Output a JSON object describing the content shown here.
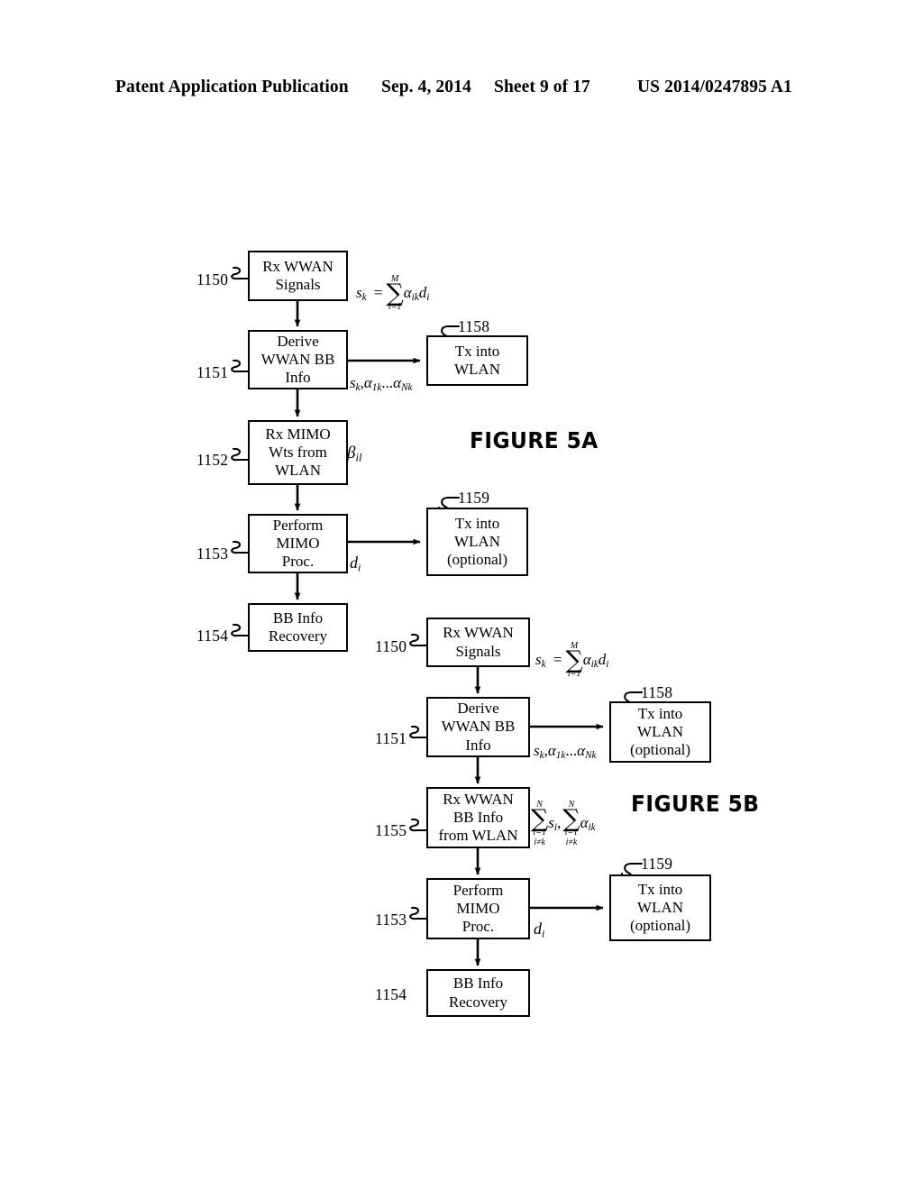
{
  "header": {
    "publication": "Patent Application Publication",
    "date": "Sep. 4, 2014",
    "sheet": "Sheet 9 of 17",
    "patent_number": "US 2014/0247895 A1"
  },
  "figures": [
    {
      "caption": "FIGURE 5A",
      "boxes": [
        {
          "ref": "1150",
          "lines": [
            "Rx WWAN",
            "Signals"
          ]
        },
        {
          "ref": "1151",
          "lines": [
            "Derive",
            "WWAN BB",
            "Info"
          ]
        },
        {
          "ref": "1158",
          "lines": [
            "Tx into",
            "WLAN"
          ]
        },
        {
          "ref": "1152",
          "lines": [
            "Rx MIMO",
            "Wts from",
            "WLAN"
          ]
        },
        {
          "ref": "1153",
          "lines": [
            "Perform",
            "MIMO",
            "Proc."
          ]
        },
        {
          "ref": "1159",
          "lines": [
            "Tx into",
            "WLAN",
            "(optional)"
          ]
        },
        {
          "ref": "1154",
          "lines": [
            "BB Info",
            "Recovery"
          ]
        }
      ],
      "equations": {
        "sk_sum": {
          "lhs": "s",
          "lhs_sub": "k",
          "eq": "=",
          "sum_top": "M",
          "sum_bot": "i=1",
          "term1": "α",
          "term1_sub": "ik",
          "term2": "d",
          "term2_sub": "i"
        },
        "sk_alphas": "s_k , α_1k ... α_Nk",
        "beta": {
          "sym": "β",
          "sub": "il"
        },
        "di": {
          "sym": "d",
          "sub": "i"
        }
      }
    },
    {
      "caption": "FIGURE 5B",
      "boxes": [
        {
          "ref": "1150",
          "lines": [
            "Rx WWAN",
            "Signals"
          ]
        },
        {
          "ref": "1151",
          "lines": [
            "Derive",
            "WWAN BB",
            "Info"
          ]
        },
        {
          "ref": "1158",
          "lines": [
            "Tx into",
            "WLAN",
            "(optional)"
          ]
        },
        {
          "ref": "1155",
          "lines": [
            "Rx WWAN",
            "BB Info",
            "from WLAN"
          ]
        },
        {
          "ref": "1153",
          "lines": [
            "Perform",
            "MIMO",
            "Proc."
          ]
        },
        {
          "ref": "1159",
          "lines": [
            "Tx into",
            "WLAN",
            "(optional)"
          ]
        },
        {
          "ref": "1154",
          "lines": [
            "BB Info",
            "Recovery"
          ]
        }
      ],
      "equations": {
        "sk_sum": {
          "lhs": "s",
          "lhs_sub": "k",
          "eq": "=",
          "sum_top": "M",
          "sum_bot": "i=1",
          "term1": "α",
          "term1_sub": "ik",
          "term2": "d",
          "term2_sub": "i"
        },
        "sk_alphas": "s_k , α_1k ... α_Nk",
        "double_sum": {
          "sum_top": "N",
          "sum_bot_l1": "i=1",
          "sum_bot_l2": "i≠k",
          "term1": "s",
          "term1_sub": "i",
          "comma": ",",
          "term2": "α",
          "term2_sub": "ik"
        },
        "di": {
          "sym": "d",
          "sub": "i"
        }
      }
    }
  ],
  "labels": {
    "s_char": "s",
    "k_sub": "k",
    "alpha": "α",
    "beta": "β",
    "d_char": "d",
    "i_sub": "i",
    "il_sub": "il",
    "ik_sub": "ik",
    "one_k_sub": "1k",
    "N_k_sub": "Nk",
    "equals": "=",
    "comma": ",",
    "ellipsis": "...",
    "sum_upper_M": "M",
    "sum_lower_i1": "i=1",
    "sum_upper_N": "N",
    "sum_lower_ineqk": "i≠k"
  },
  "colors": {
    "ink": "#000000",
    "paper": "#ffffff"
  }
}
